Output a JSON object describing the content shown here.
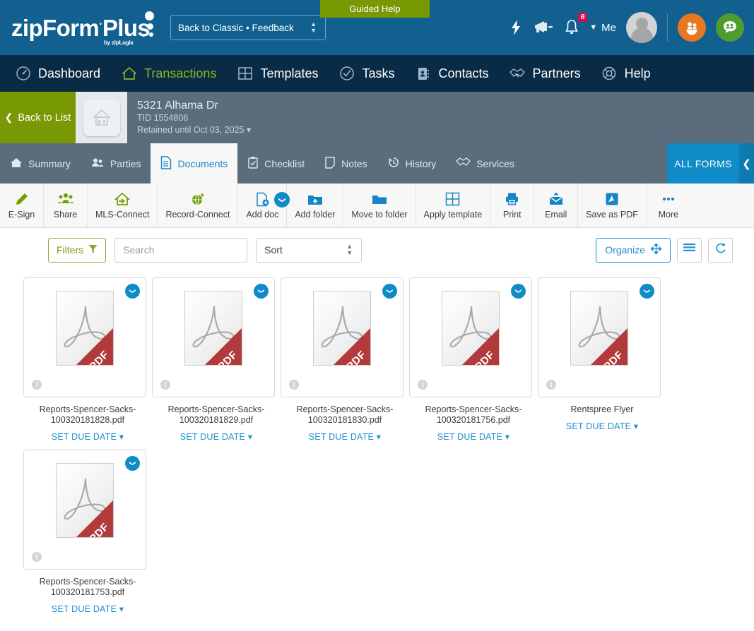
{
  "header": {
    "logo_main": "zipForm",
    "logo_mark": "Plus",
    "logo_sub": "by zipLogix",
    "classic_select": "Back to Classic • Feedback",
    "guided_help": "Guided Help",
    "me_label": "Me",
    "notification_count": "6",
    "icons": {
      "bolt": "bolt-icon",
      "megaphone": "megaphone-icon",
      "bell": "bell-icon",
      "avatar": "avatar",
      "partners": "partners-circle-icon",
      "community": "community-circle-icon"
    },
    "colors": {
      "bar": "#116090",
      "accent_green": "#789904",
      "badge_red": "#d50f4c"
    }
  },
  "mainnav": {
    "items": [
      {
        "label": "Dashboard",
        "icon": "gauge-icon",
        "active": false
      },
      {
        "label": "Transactions",
        "icon": "house-icon",
        "active": true
      },
      {
        "label": "Templates",
        "icon": "grid-icon",
        "active": false
      },
      {
        "label": "Tasks",
        "icon": "check-circle-icon",
        "active": false
      },
      {
        "label": "Contacts",
        "icon": "address-book-icon",
        "active": false
      },
      {
        "label": "Partners",
        "icon": "handshake-icon",
        "active": false
      },
      {
        "label": "Help",
        "icon": "life-ring-icon",
        "active": false
      }
    ],
    "colors": {
      "bar": "#0a2b45",
      "active": "#8ab620"
    }
  },
  "transaction": {
    "back_label": "Back to List",
    "address": "5321 Alhama Dr",
    "tid": "TID 1554806",
    "retained": "Retained until Oct 03, 2025"
  },
  "tabs": {
    "items": [
      {
        "label": "Summary",
        "icon": "home-icon",
        "active": false
      },
      {
        "label": "Parties",
        "icon": "people-icon",
        "active": false
      },
      {
        "label": "Documents",
        "icon": "document-icon",
        "active": true
      },
      {
        "label": "Checklist",
        "icon": "clipboard-check-icon",
        "active": false
      },
      {
        "label": "Notes",
        "icon": "note-icon",
        "active": false
      },
      {
        "label": "History",
        "icon": "history-icon",
        "active": false
      },
      {
        "label": "Services",
        "icon": "handshake-icon",
        "active": false
      }
    ],
    "all_forms": "ALL FORMS"
  },
  "toolbar": {
    "items": [
      {
        "label": "E-Sign",
        "icon": "pen-icon",
        "color": "green"
      },
      {
        "label": "Share",
        "icon": "share-people-icon",
        "color": "green"
      },
      {
        "label": "MLS-Connect",
        "icon": "house-arrow-icon",
        "color": "green"
      },
      {
        "label": "Record-Connect",
        "icon": "globe-pin-icon",
        "color": "green"
      },
      {
        "label": "Add doc",
        "icon": "add-document-icon",
        "color": "blue"
      },
      {
        "label": "Add folder",
        "icon": "add-folder-icon",
        "color": "blue"
      },
      {
        "label": "Move to folder",
        "icon": "folder-icon",
        "color": "blue"
      },
      {
        "label": "Apply template",
        "icon": "grid-icon",
        "color": "blue"
      },
      {
        "label": "Print",
        "icon": "printer-icon",
        "color": "blue"
      },
      {
        "label": "Email",
        "icon": "envelope-up-icon",
        "color": "blue"
      },
      {
        "label": "Save as PDF",
        "icon": "pdf-icon",
        "color": "blue"
      },
      {
        "label": "More",
        "icon": "ellipsis-icon",
        "color": "blue"
      }
    ]
  },
  "filterbar": {
    "filters_label": "Filters",
    "search_placeholder": "Search",
    "search_value": "",
    "sort_label": "Sort",
    "organize_label": "Organize",
    "list_view_icon": "list-view-icon",
    "refresh_icon": "refresh-icon"
  },
  "documents": {
    "due_date_label": "SET DUE DATE",
    "items": [
      {
        "name": "Reports-Spencer-Sacks-100320181828.pdf",
        "type": "PDF"
      },
      {
        "name": "Reports-Spencer-Sacks-100320181829.pdf",
        "type": "PDF"
      },
      {
        "name": "Reports-Spencer-Sacks-100320181830.pdf",
        "type": "PDF"
      },
      {
        "name": "Reports-Spencer-Sacks-100320181756.pdf",
        "type": "PDF"
      },
      {
        "name": "Rentspree Flyer",
        "type": "PDF"
      },
      {
        "name": "Reports-Spencer-Sacks-100320181753.pdf",
        "type": "PDF"
      }
    ]
  }
}
